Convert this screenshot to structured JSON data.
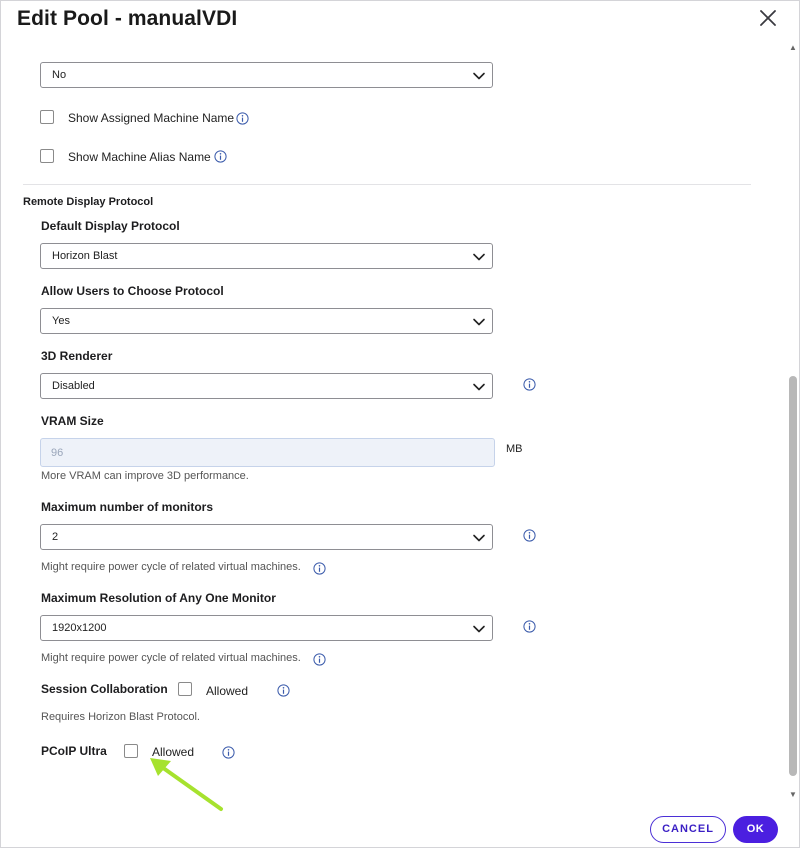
{
  "dialog": {
    "title": "Edit Pool - manualVDI"
  },
  "top": {
    "select_value": "No",
    "show_assigned_label": "Show Assigned Machine Name",
    "show_alias_label": "Show Machine Alias Name"
  },
  "remote": {
    "section_title": "Remote Display Protocol",
    "default_protocol_label": "Default Display Protocol",
    "default_protocol_value": "Horizon Blast",
    "allow_choose_label": "Allow Users to Choose Protocol",
    "allow_choose_value": "Yes",
    "renderer_label": "3D Renderer",
    "renderer_value": "Disabled",
    "vram_label": "VRAM Size",
    "vram_value": "96",
    "vram_unit": "MB",
    "vram_help": "More VRAM can improve 3D performance.",
    "monitors_label": "Maximum number of monitors",
    "monitors_value": "2",
    "monitors_help": "Might require power cycle of related virtual machines.",
    "resolution_label": "Maximum Resolution of Any One Monitor",
    "resolution_value": "1920x1200",
    "resolution_help": "Might require power cycle of related virtual machines.",
    "collab_label": "Session Collaboration",
    "collab_checkbox_label": "Allowed",
    "collab_help": "Requires Horizon Blast Protocol.",
    "pcoip_label": "PCoIP Ultra",
    "pcoip_checkbox_label": "Allowed"
  },
  "footer": {
    "cancel_label": "CANCEL",
    "ok_label": "OK"
  },
  "colors": {
    "accent": "#4b1fe0",
    "info_blue": "#3b5bab",
    "annotation_arrow": "#a6e22e"
  },
  "icons": {
    "close": "close-icon",
    "info": "info-icon",
    "chevron": "chevron-down-icon"
  }
}
